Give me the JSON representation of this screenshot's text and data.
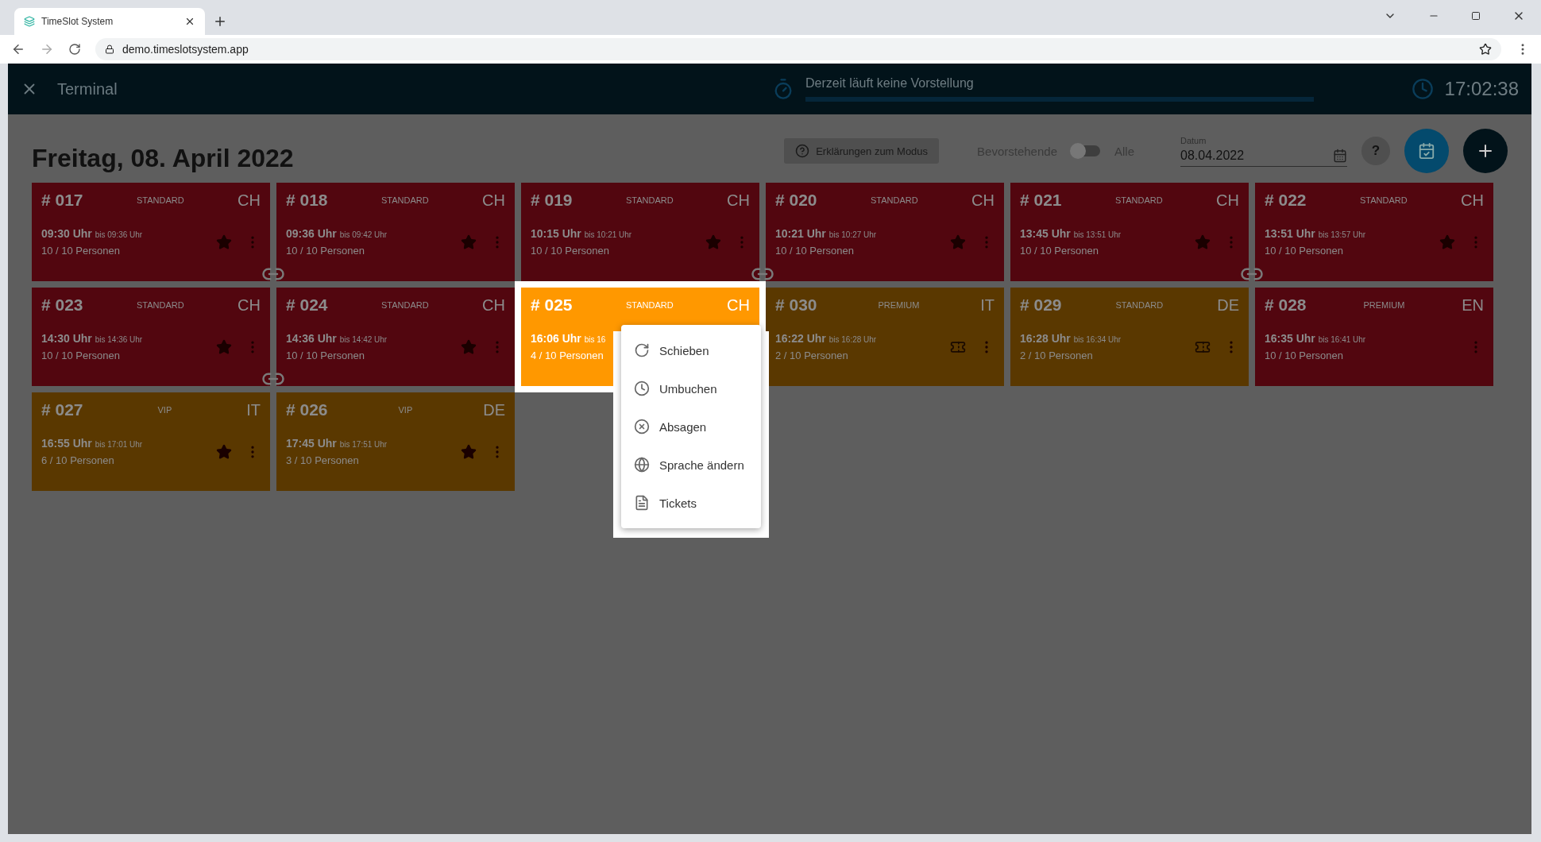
{
  "browser": {
    "tab_title": "TimeSlot System",
    "url": "demo.timeslotsystem.app"
  },
  "header": {
    "title": "Terminal",
    "status": "Derzeit läuft keine Vorstellung",
    "progress": {
      "level": 0
    },
    "time": "17:02:38"
  },
  "toolbar": {
    "date_heading": "Freitag, 08. April 2022",
    "help_button": "Erklärungen zum Modus",
    "toggle_left": "Bevorstehende",
    "toggle_on": false,
    "toggle_right": "Alle",
    "date_label": "Datum",
    "date_value": "08.04.2022",
    "question_button": "?"
  },
  "slots": [
    {
      "number": "# 017",
      "tier": "STANDARD",
      "lang": "CH",
      "start": "09:30 Uhr",
      "end": "bis 09:36 Uhr",
      "persons": "10 / 10 Personen",
      "color": "#52060f",
      "kind": "starred",
      "linked": true,
      "selected": false
    },
    {
      "number": "# 018",
      "tier": "STANDARD",
      "lang": "CH",
      "start": "09:36 Uhr",
      "end": "bis 09:42 Uhr",
      "persons": "10 / 10 Personen",
      "color": "#52060f",
      "kind": "starred",
      "linked": false,
      "selected": false
    },
    {
      "number": "# 019",
      "tier": "STANDARD",
      "lang": "CH",
      "start": "10:15 Uhr",
      "end": "bis 10:21 Uhr",
      "persons": "10 / 10 Personen",
      "color": "#52060f",
      "kind": "starred",
      "linked": true,
      "selected": false
    },
    {
      "number": "# 020",
      "tier": "STANDARD",
      "lang": "CH",
      "start": "10:21 Uhr",
      "end": "bis 10:27 Uhr",
      "persons": "10 / 10 Personen",
      "color": "#52060f",
      "kind": "starred",
      "linked": false,
      "selected": false
    },
    {
      "number": "# 021",
      "tier": "STANDARD",
      "lang": "CH",
      "start": "13:45 Uhr",
      "end": "bis 13:51 Uhr",
      "persons": "10 / 10 Personen",
      "color": "#52060f",
      "kind": "starred",
      "linked": true,
      "selected": false
    },
    {
      "number": "# 022",
      "tier": "STANDARD",
      "lang": "CH",
      "start": "13:51 Uhr",
      "end": "bis 13:57 Uhr",
      "persons": "10 / 10 Personen",
      "color": "#52060f",
      "kind": "starred",
      "linked": false,
      "selected": false
    },
    {
      "number": "# 023",
      "tier": "STANDARD",
      "lang": "CH",
      "start": "14:30 Uhr",
      "end": "bis 14:36 Uhr",
      "persons": "10 / 10 Personen",
      "color": "#52060f",
      "kind": "starred",
      "linked": true,
      "selected": false
    },
    {
      "number": "# 024",
      "tier": "STANDARD",
      "lang": "CH",
      "start": "14:36 Uhr",
      "end": "bis 14:42 Uhr",
      "persons": "10 / 10 Personen",
      "color": "#52060f",
      "kind": "starred",
      "linked": false,
      "selected": false
    },
    {
      "number": "# 025",
      "tier": "STANDARD",
      "lang": "CH",
      "start": "16:06 Uhr",
      "end": "bis 16",
      "persons": "4 / 10 Personen",
      "color": "#ff9800",
      "linked": false,
      "selected": true
    },
    {
      "number": "# 030",
      "tier": "PREMIUM",
      "lang": "IT",
      "start": "16:22 Uhr",
      "end": "bis 16:28 Uhr",
      "persons": "2 / 10 Personen",
      "color": "#5a3800",
      "kind": "ticketed",
      "linked": false,
      "selected": false
    },
    {
      "number": "# 029",
      "tier": "STANDARD",
      "lang": "DE",
      "start": "16:28 Uhr",
      "end": "bis 16:34 Uhr",
      "persons": "2 / 10 Personen",
      "color": "#5a3800",
      "kind": "ticketed",
      "linked": false,
      "selected": false
    },
    {
      "number": "# 028",
      "tier": "PREMIUM",
      "lang": "EN",
      "start": "16:35 Uhr",
      "end": "bis 16:41 Uhr",
      "persons": "10 / 10 Personen",
      "color": "#52060f",
      "kind": "plain",
      "linked": false,
      "selected": false
    },
    {
      "number": "# 027",
      "tier": "VIP",
      "lang": "IT",
      "start": "16:55 Uhr",
      "end": "bis 17:01 Uhr",
      "persons": "6 / 10 Personen",
      "color": "#5a3800",
      "kind": "starred",
      "linked": false,
      "selected": false
    },
    {
      "number": "# 026",
      "tier": "VIP",
      "lang": "DE",
      "start": "17:45 Uhr",
      "end": "bis 17:51 Uhr",
      "persons": "3 / 10 Personen",
      "color": "#5a3800",
      "kind": "starred",
      "linked": false,
      "selected": false
    }
  ],
  "context_menu": [
    {
      "label": "Schieben",
      "kind": "shift"
    },
    {
      "label": "Umbuchen",
      "kind": "rebook"
    },
    {
      "label": "Absagen",
      "kind": "cancel"
    },
    {
      "label": "Sprache ändern",
      "kind": "language"
    },
    {
      "label": "Tickets",
      "kind": "tickets"
    }
  ]
}
